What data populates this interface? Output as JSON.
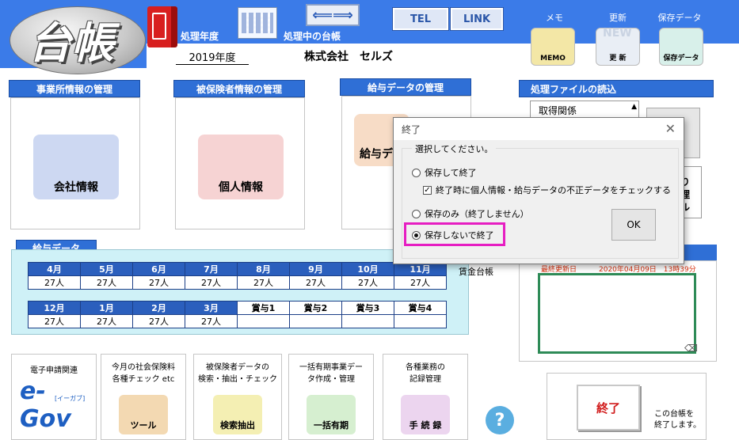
{
  "header": {
    "logo_text": "台帳",
    "year_label": "処理年度",
    "year_value": "2019年度",
    "current_ledger_label": "処理中の台帳",
    "company_name": "株式会社　セルズ",
    "tel_label": "TEL",
    "link_label": "LINK",
    "memo_label": "メモ",
    "memo_icon_text": "MEMO",
    "update_label": "更新",
    "update_icon_text": "更 新",
    "update_badge": "NEW",
    "save_label": "保存データ",
    "save_icon_text": "保存データ"
  },
  "sections": {
    "office": {
      "title": "事業所情報の管理",
      "button": "会社情報"
    },
    "insured": {
      "title": "被保険者情報の管理",
      "button": "個人情報"
    },
    "salary": {
      "title": "給与データの管理",
      "button": "給与デー"
    },
    "file_load": {
      "title": "処理ファイルの読込",
      "list_item": "取得関係",
      "side_text_1": "り",
      "side_text_2": "理",
      "side_text_3": "ル"
    }
  },
  "salary_grid": {
    "title": "給与データ",
    "row1_headers": [
      "4月",
      "5月",
      "6月",
      "7月",
      "8月",
      "9月",
      "10月",
      "11月"
    ],
    "row1_values": [
      "27人",
      "27人",
      "27人",
      "27人",
      "27人",
      "27人",
      "27人",
      "27人"
    ],
    "row2_headers": [
      "12月",
      "1月",
      "2月",
      "3月",
      "賞与1",
      "賞与2",
      "賞与3",
      "賞与4"
    ],
    "row2_values": [
      "27人",
      "27人",
      "27人",
      "27人",
      "",
      "",
      "",
      ""
    ],
    "wage_ledger_label": "賃金台帳"
  },
  "memo_panel": {
    "last_updated_label": "最終更新日",
    "last_updated_value": "2020年04月09日　13時39分"
  },
  "tools": {
    "egov_title": "電子申請関連",
    "egov_logo": "e-Gov",
    "egov_sub": "[イーガブ]",
    "check_title_1": "今月の社会保険料",
    "check_title_2": "各種チェック etc",
    "check_button": "ツール",
    "search_title_1": "被保険者データの",
    "search_title_2": "検索・抽出・チェック",
    "search_button": "検索抽出",
    "bulk_title_1": "一括有期事業デー",
    "bulk_title_2": "タ作成・管理",
    "bulk_button": "一括有期",
    "records_title_1": "各種業務の",
    "records_title_2": "記録管理",
    "records_button": "手 続 録",
    "help_symbol": "?",
    "exit_button": "終了",
    "exit_desc_1": "この台帳を",
    "exit_desc_2": "終了します。"
  },
  "dialog": {
    "title": "終了",
    "close_symbol": "✕",
    "prompt": "選択してください。",
    "option_save_exit": "保存して終了",
    "check_on_exit": "終了時に個人情報・給与データの不正データをチェックする",
    "option_save_only": "保存のみ（終了しません）",
    "option_no_save": "保存しないで終了",
    "ok_label": "OK"
  }
}
